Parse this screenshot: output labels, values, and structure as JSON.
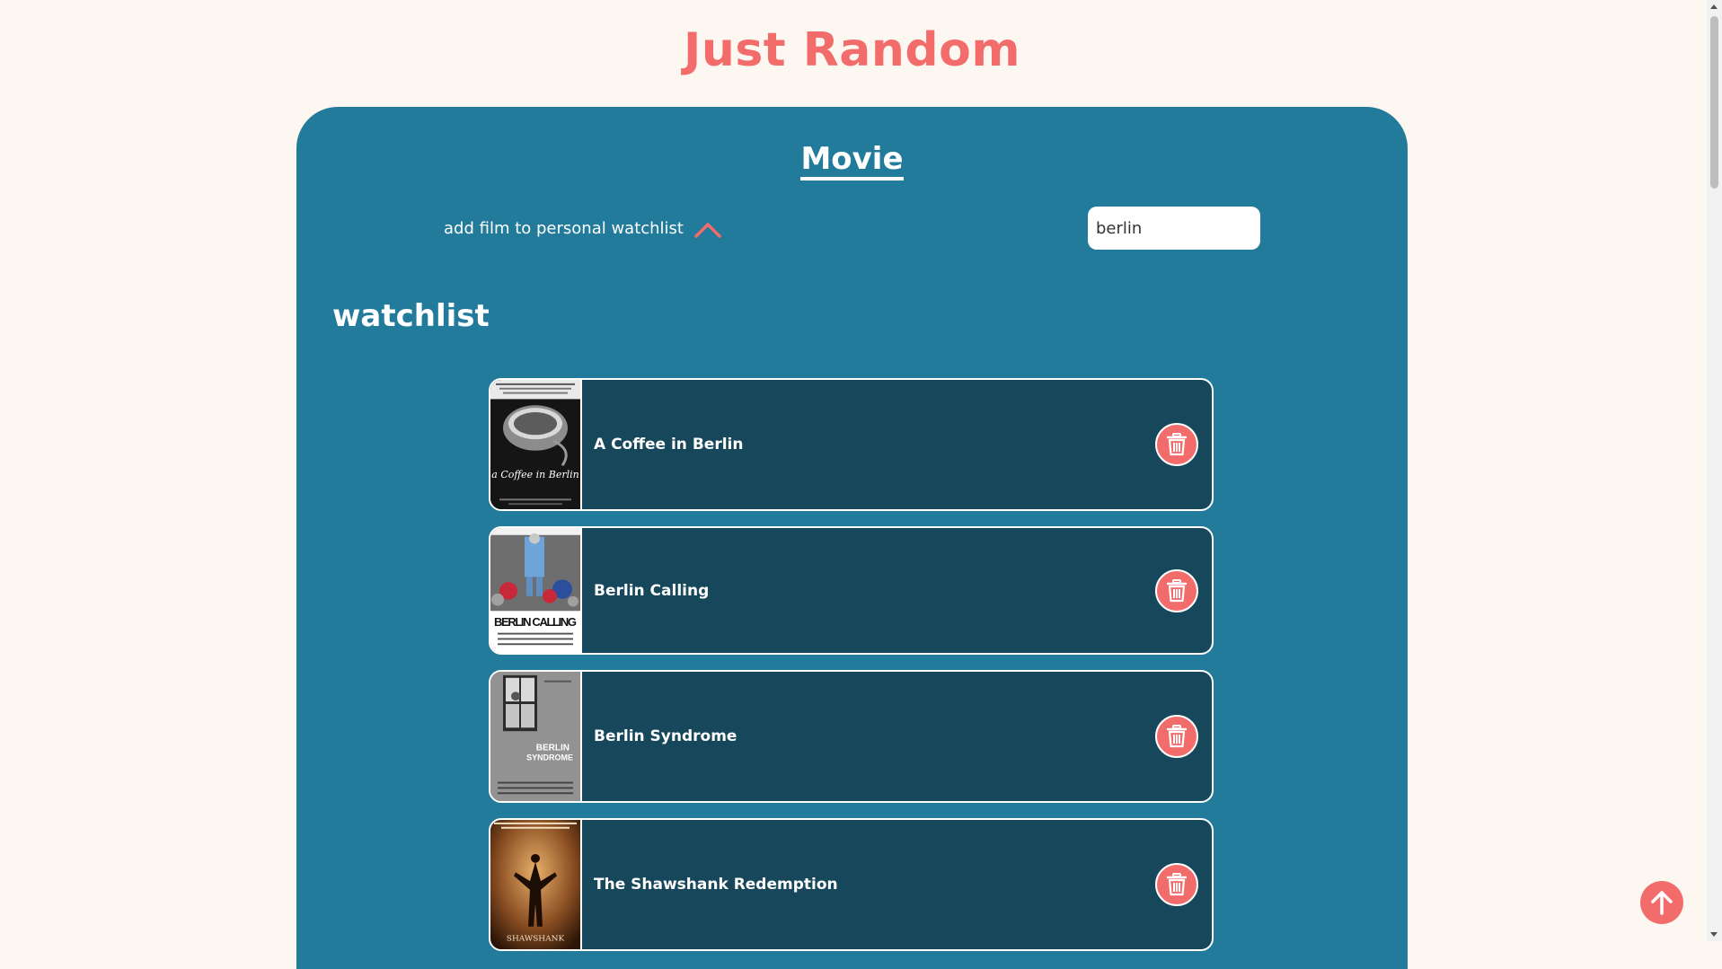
{
  "header": {
    "title": "Just Random"
  },
  "section": {
    "title": "Movie"
  },
  "controls": {
    "add_toggle_label": "add film to personal watchlist",
    "search_value": "berlin"
  },
  "watchlist": {
    "title": "watchlist",
    "items": [
      {
        "title": "A Coffee in Berlin",
        "poster_text": "a Coffee in Berlin"
      },
      {
        "title": "Berlin Calling",
        "poster_text": "BERLIN CALLING"
      },
      {
        "title": "Berlin Syndrome",
        "poster_text": "BERLIN SYNDROME"
      },
      {
        "title": "The Shawshank Redemption",
        "poster_text": "SHAWSHANK"
      }
    ]
  },
  "colors": {
    "background": "#fdf7f1",
    "accent": "#f36c6c",
    "panel": "#227b9b",
    "card": "#16475a"
  },
  "icons": {
    "toggle": "chevron-up-icon",
    "delete": "trash-icon",
    "scroll_top": "arrow-up-icon"
  }
}
